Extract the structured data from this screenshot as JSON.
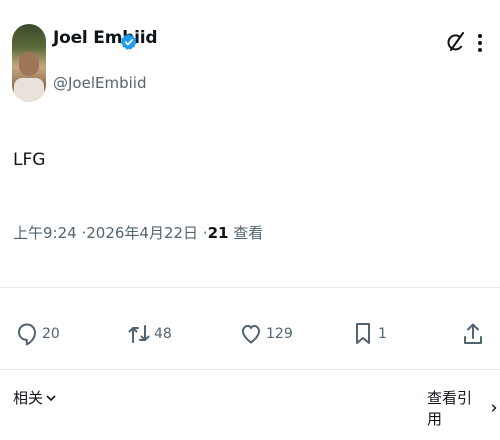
{
  "author": {
    "name": "Joel Embiid",
    "handle": "@JoelEmbiid",
    "verified": true
  },
  "tweet": {
    "text": "LFG",
    "time": "上午9:24",
    "date": "2026年4月22日",
    "views_count": "21",
    "views_label": "查看",
    "separator": "·"
  },
  "actions": {
    "replies": "20",
    "retweets": "48",
    "likes": "129",
    "bookmarks": "1"
  },
  "footer": {
    "related_label": "相关",
    "view_quotes_label": "查看引用"
  },
  "colors": {
    "text_primary": "#0f1419",
    "text_secondary": "#536471",
    "verified_blue": "#1d9bf0",
    "divider": "#e6ecf0"
  }
}
